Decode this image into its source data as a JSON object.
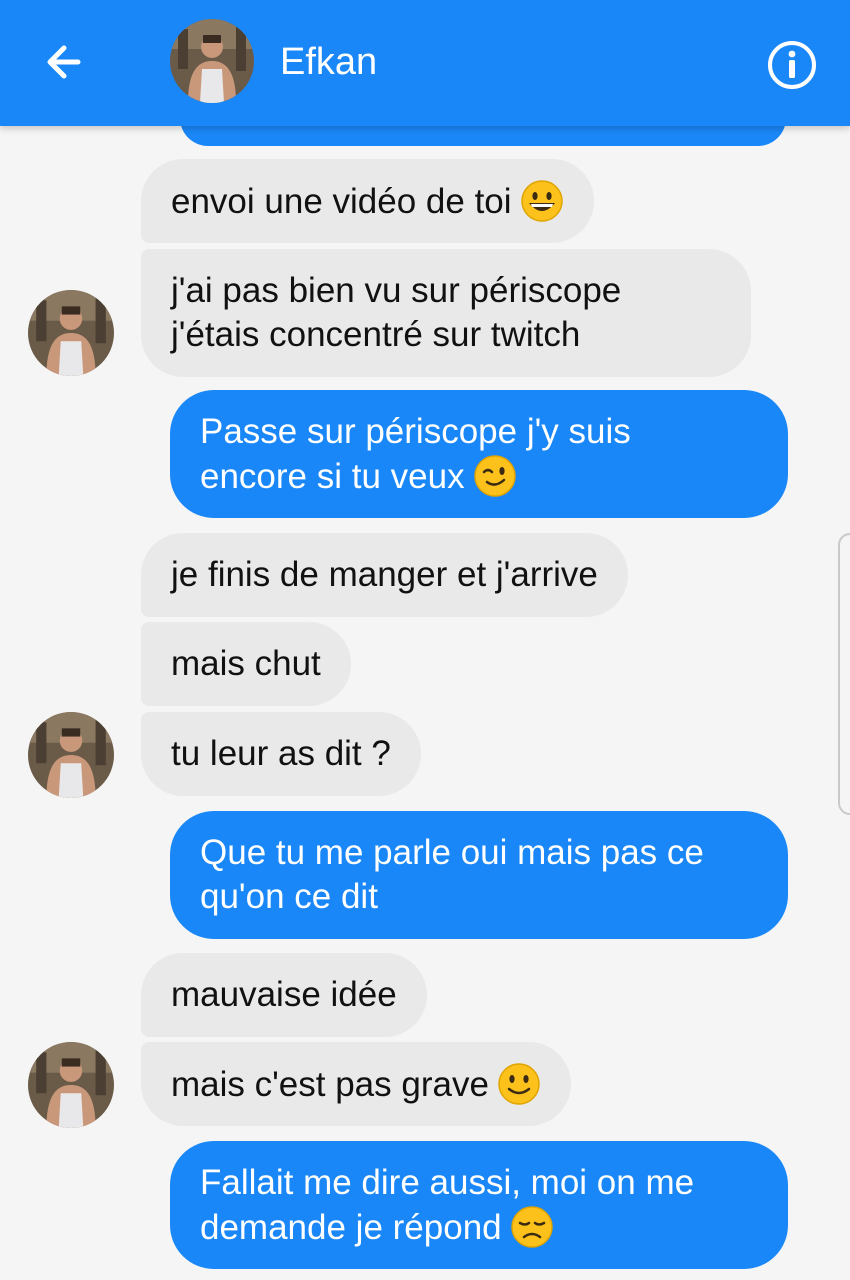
{
  "header": {
    "contact_name": "Efkan",
    "back_icon": "arrow-left-icon",
    "info_icon": "info-circle-icon",
    "bar_color": "#1a87f8"
  },
  "messages": [
    {
      "from": "contact",
      "lines": [
        "envoi une vidéo de toi"
      ],
      "emoji": "grinning-face"
    },
    {
      "from": "contact",
      "lines": [
        "j'ai pas bien vu sur périscope",
        "j'étais concentré sur twitch"
      ]
    },
    {
      "from": "me",
      "lines": [
        "Passe sur périscope j'y suis",
        "encore si tu veux"
      ],
      "emoji": "winking-face"
    },
    {
      "from": "contact",
      "lines": [
        "je finis de manger et j'arrive"
      ]
    },
    {
      "from": "contact",
      "lines": [
        "mais chut"
      ]
    },
    {
      "from": "contact",
      "lines": [
        "tu leur as dit ?"
      ]
    },
    {
      "from": "me",
      "lines": [
        "Que tu me parle oui mais pas ce",
        "qu'on ce dit"
      ]
    },
    {
      "from": "contact",
      "lines": [
        "mauvaise idée"
      ]
    },
    {
      "from": "contact",
      "lines": [
        "mais c'est pas grave"
      ],
      "emoji": "slightly-smiling-face"
    },
    {
      "from": "me",
      "lines": [
        "Fallait me dire aussi, moi on me",
        "demande je répond"
      ],
      "emoji": "disappointed-face"
    }
  ],
  "colors": {
    "outgoing_bubble": "#1a87f8",
    "incoming_bubble": "#e9e9e9",
    "background": "#f5f5f5"
  }
}
